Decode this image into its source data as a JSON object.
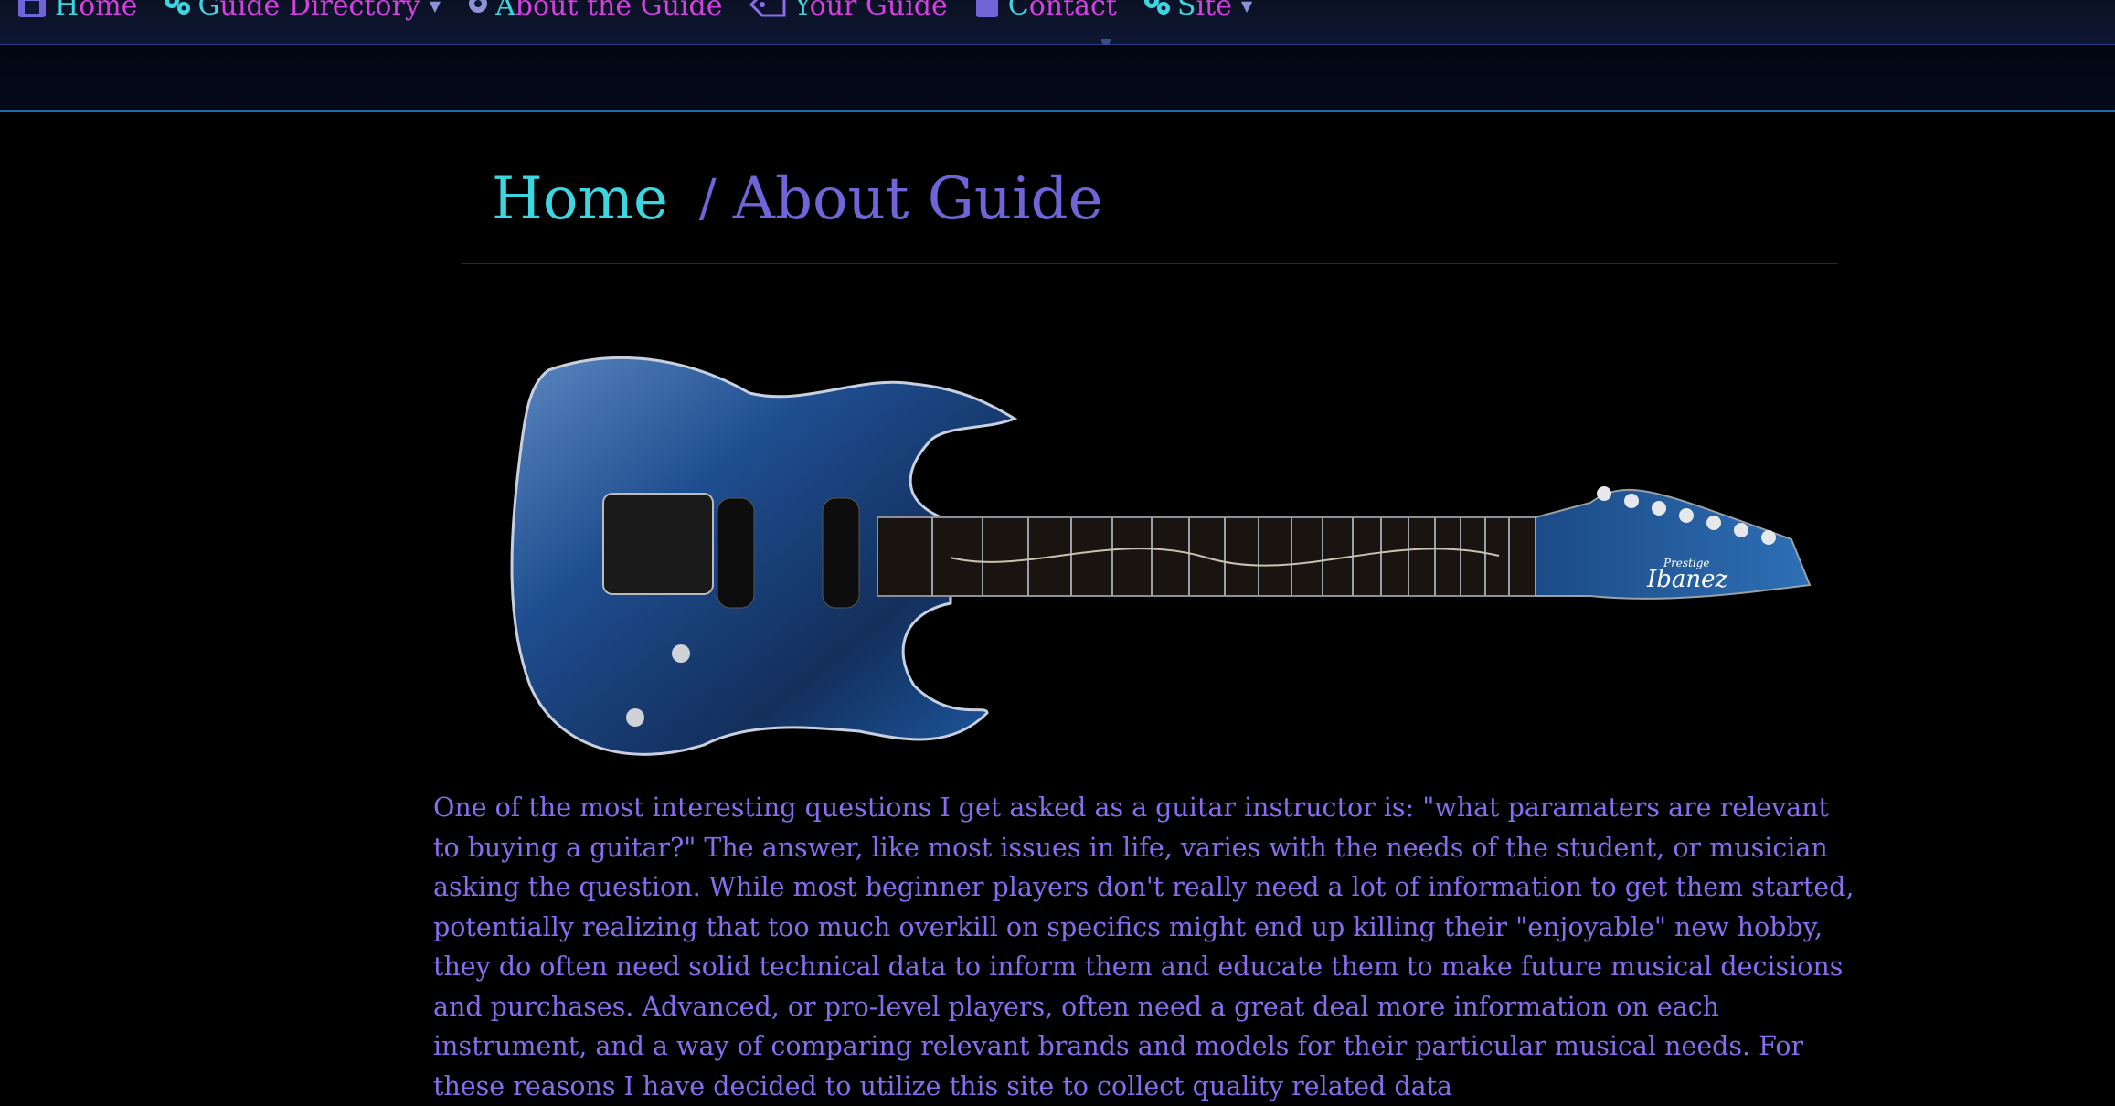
{
  "nav": {
    "items": [
      {
        "cap": "H",
        "rest": "ome",
        "icon": "home-icon",
        "dropdown": false
      },
      {
        "cap": "G",
        "rest": "uide Directory",
        "icon": "gears-icon",
        "dropdown": true
      },
      {
        "cap": "A",
        "rest": "bout the Guide",
        "icon": "gear-icon",
        "dropdown": false
      },
      {
        "cap": "Y",
        "rest": "our Guide",
        "icon": "tag-icon",
        "dropdown": false
      },
      {
        "cap": "C",
        "rest": "ontact",
        "icon": "clipboard-icon",
        "dropdown": false
      },
      {
        "cap": "S",
        "rest": "ite",
        "icon": "gears-icon",
        "dropdown": true
      }
    ]
  },
  "breadcrumb": {
    "home": "Home",
    "separator": "/",
    "current": "About Guide"
  },
  "guitar": {
    "logo_text": "Ibanez",
    "logo_sub": "Prestige"
  },
  "body": {
    "intro": "One of the most interesting questions I get asked as a guitar instructor is: \"what paramaters are relevant to buying a guitar?\" The answer, like most issues in life, varies with the needs of the student, or musician asking the question. While most beginner players don't really need a lot of information to get them started, potentially realizing that too much overkill on specifics might end up killing their \"enjoyable\" new hobby, they do often need solid technical data to inform them and educate them to make future musical decisions and purchases. Advanced, or pro-level players, often need a great deal more information on each instrument, and a way of comparing relevant brands and models for their particular musical needs. For these reasons I have decided to utilize this site to collect quality related data"
  },
  "colors": {
    "nav_text": "#d63fe0",
    "nav_cap": "#3bd6e0",
    "crumb_home": "#3bd6e0",
    "crumb_current": "#6f64d8",
    "body_text": "#8a6cf0"
  }
}
